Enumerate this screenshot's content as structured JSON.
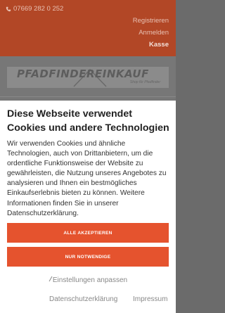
{
  "background": {
    "phone": "07669 282 0 252",
    "nav": {
      "register": "Registrieren",
      "login": "Anmelden",
      "checkout": "Kasse"
    },
    "logo_text": "PFADFINDEREINKAUF",
    "logo_subtitle": "Shop für Pfadfinder"
  },
  "cookie_modal": {
    "title": "Diese Webseite verwendet Cookies und andere Technologien",
    "text_intro": "Wir verwenden Cookies und ähnliche Technologien, auch von Drittanbietern, um die ordentliche Funktionsweise der Website zu gewährleisten, die Nutzung unseres Angebotes zu analysieren und Ihnen ein bestmögliches Einkaufserlebnis bieten zu können. Weitere Informationen finden Sie in unserer ",
    "text_link": "Datenschutzerklärung",
    "text_end": ".",
    "accept_all_label": "ALLE AKZEPTIEREN",
    "necessary_only_label": "NUR NOTWENDIGE",
    "settings_label": "Einstellungen anpassen",
    "privacy_link": "Datenschutzerklärung",
    "imprint_link": "Impressum"
  },
  "colors": {
    "header_dimmed": "#b24726",
    "accent": "#e5532e"
  }
}
